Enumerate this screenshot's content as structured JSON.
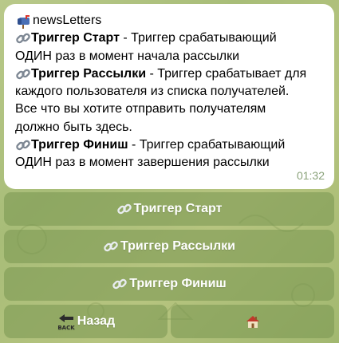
{
  "message": {
    "channel_label": "newsLetters",
    "items": [
      {
        "term": "Триггер Старт",
        "desc_lines": [
          " - Триггер срабатывающий",
          "ОДИН раз в момент начала рассылки"
        ]
      },
      {
        "term": "Триггер Рассылки",
        "desc_lines": [
          " - Триггер срабатывает для",
          "каждого пользователя из списка получателей.",
          "Все что вы хотите отправить получателям",
          "должно быть здесь."
        ]
      },
      {
        "term": "Триггер Финиш",
        "desc_lines": [
          " - Триггер срабатывающий",
          "ОДИН раз в момент завершения рассылки"
        ]
      }
    ],
    "time": "01:32"
  },
  "keyboard": {
    "start_label": "Триггер Старт",
    "mailing_label": "Триггер Рассылки",
    "finish_label": "Триггер Финиш",
    "back_label": "Назад",
    "back_icon_text": "BACK",
    "home_icon": "house-icon"
  },
  "colors": {
    "bubble": "#ffffff",
    "button": "#7e9650",
    "time": "#8aa27a"
  }
}
